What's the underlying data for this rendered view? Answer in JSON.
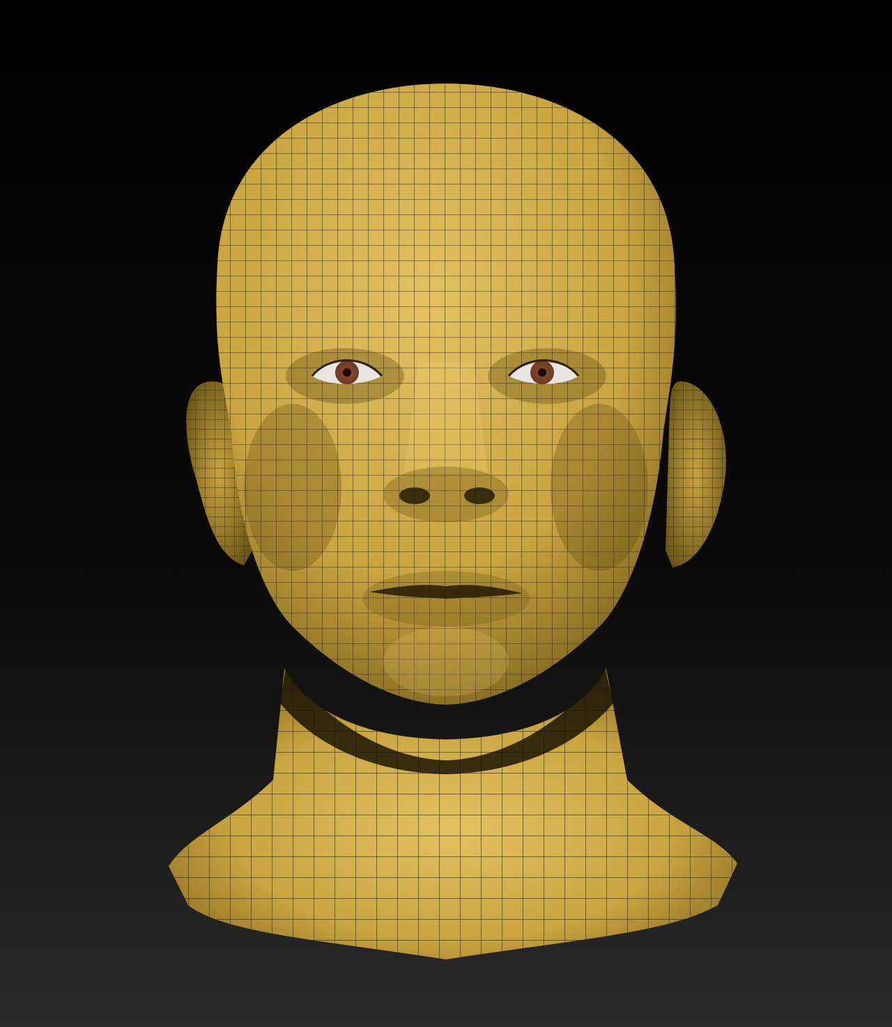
{
  "scene": {
    "subject": "sculpted-head-wireframe",
    "colors": {
      "background_top": "#000000",
      "background_bottom": "#2a2a2a",
      "surface_light": "#e3c261",
      "surface_mid": "#c9a43f",
      "surface_dark": "#6e5716",
      "shadow": "#1c1505",
      "wire": "#3a2e0a",
      "iris": "#6b3a22",
      "pupil": "#1a0d07",
      "sclera": "#e8e6e2"
    },
    "mesh": {
      "grid_lines": true,
      "style": "quad-topology"
    }
  }
}
